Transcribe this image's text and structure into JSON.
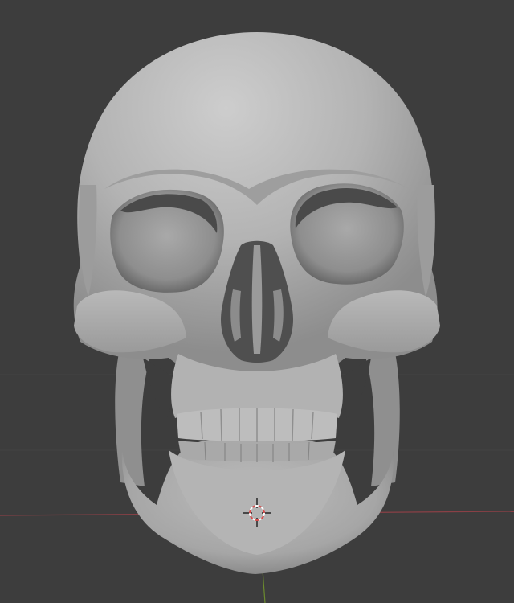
{
  "viewport": {
    "background_color": "#3d3d3d",
    "grid_line_color": "#474747",
    "x_axis_color": "#8a4046",
    "y_axis_color": "#6b8a2e"
  },
  "model": {
    "object": "skull",
    "shade_color": "#a3a3a3",
    "highlight_color": "#c9c9c9",
    "shadow_color": "#5a5a5a"
  },
  "cursor_3d": {
    "icon": "3d-cursor-icon",
    "ring_color_a": "#ffffff",
    "ring_color_b": "#d94a4a"
  }
}
